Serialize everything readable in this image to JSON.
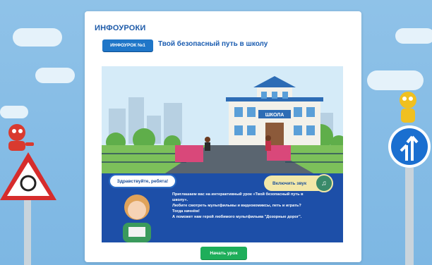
{
  "app": {
    "brand": "ИНФОУРОКИ"
  },
  "lesson": {
    "badge": "ИНФОУРОК №1",
    "title": "Твой безопасный путь в школу"
  },
  "scene": {
    "school_sign": "ШКОЛА",
    "greeting": "Здравствуйте, ребята!",
    "sound_button": "Включить звук",
    "intro_lines": [
      "Приглашаем вас на интерактивный урок «Твой безопасный путь в",
      "школу».",
      "Любите смотреть мультфильмы и видеокомиксы, петь и играть?",
      "Тогда начнём!",
      "А поможет нам герой любимого мультфильма \"Дозорные дорог\"."
    ]
  },
  "actions": {
    "start_label": "Начать урок"
  },
  "colors": {
    "accent_blue": "#1f76c8",
    "start_green": "#1eae5a",
    "title_blue": "#1a5cb0",
    "background": "#8fc2e8"
  }
}
